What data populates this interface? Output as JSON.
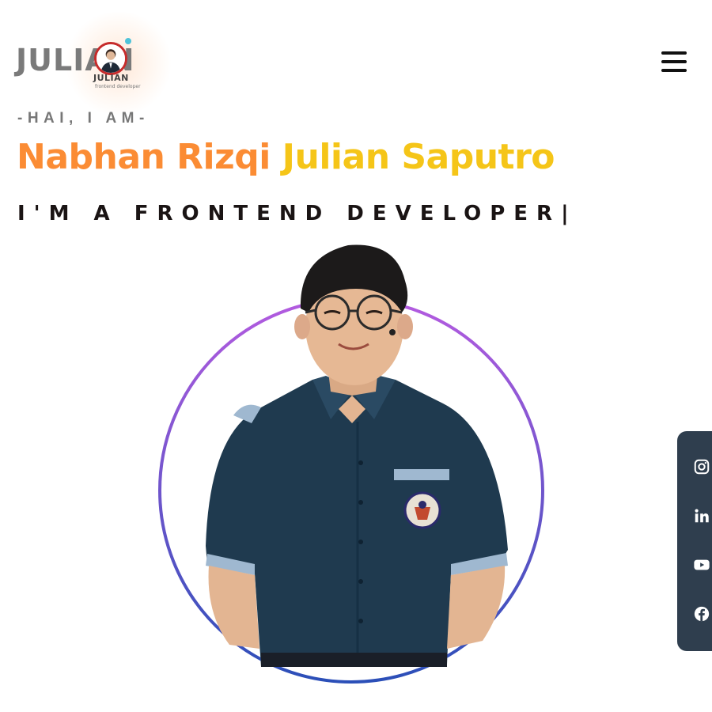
{
  "logo": {
    "wordmark": "JULIAN",
    "name": "JULIAN",
    "subtitle": "frontend developer"
  },
  "header": {
    "menu_icon": "hamburger-menu-icon"
  },
  "hero": {
    "greeting": "-HAI, I AM-",
    "name_first": "Nabhan Rizqi",
    "name_last": "Julian Saputro",
    "role": "I'M A FRONTEND DEVELOPER",
    "cursor": "|"
  },
  "social": [
    {
      "icon": "instagram-icon"
    },
    {
      "icon": "linkedin-icon"
    },
    {
      "icon": "youtube-icon"
    },
    {
      "icon": "facebook-icon"
    }
  ],
  "colors": {
    "name_first": "#fb8c34",
    "name_last": "#f5c518",
    "ring_top": "#b45be0",
    "ring_bottom": "#2b4fb8",
    "social_bar": "#2f3e4e"
  }
}
